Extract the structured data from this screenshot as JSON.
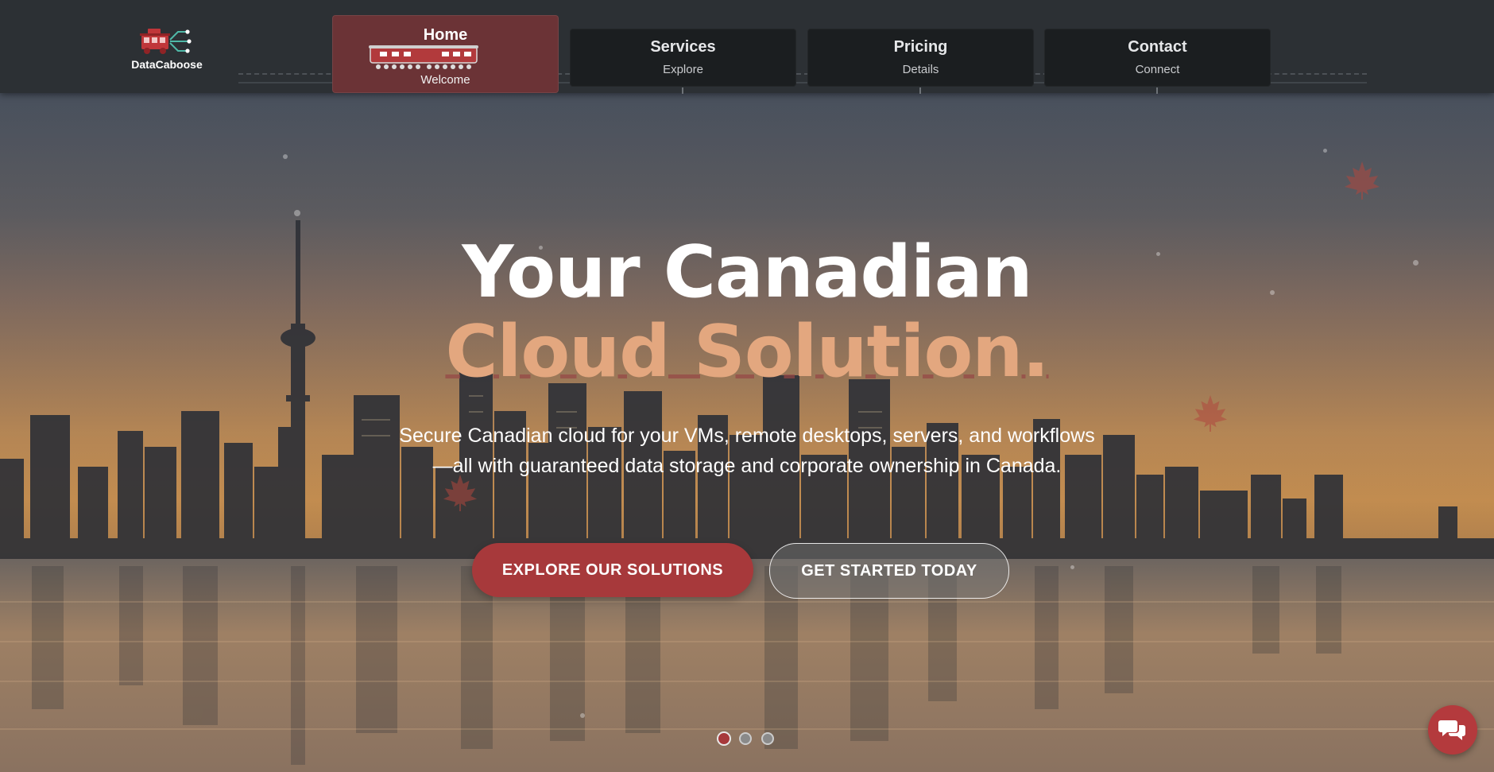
{
  "brand": {
    "name": "DataCaboose"
  },
  "nav": {
    "items": [
      {
        "title": "Home",
        "subtitle": "Welcome",
        "active": true
      },
      {
        "title": "Services",
        "subtitle": "Explore",
        "active": false
      },
      {
        "title": "Pricing",
        "subtitle": "Details",
        "active": false
      },
      {
        "title": "Contact",
        "subtitle": "Connect",
        "active": false
      }
    ]
  },
  "hero": {
    "headline_line1": "Your Canadian",
    "headline_line2": "Cloud Solution.",
    "subtitle": "Secure Canadian cloud for your VMs, remote desktops, servers, and workflows—all with guaranteed data storage and corporate ownership in Canada.",
    "primary_cta": "EXPLORE OUR SOLUTIONS",
    "secondary_cta": "GET STARTED TODAY",
    "slides": {
      "count": 3,
      "active_index": 0
    }
  },
  "colors": {
    "accent": "#a7393b",
    "headline_accent": "#e3a77f",
    "nav_background": "#2c3034",
    "nav_active": "#6b3336"
  },
  "icons": {
    "chat": "chat-bubbles-icon",
    "logo": "caboose-circuit-icon",
    "decor": "maple-leaf-icon"
  }
}
